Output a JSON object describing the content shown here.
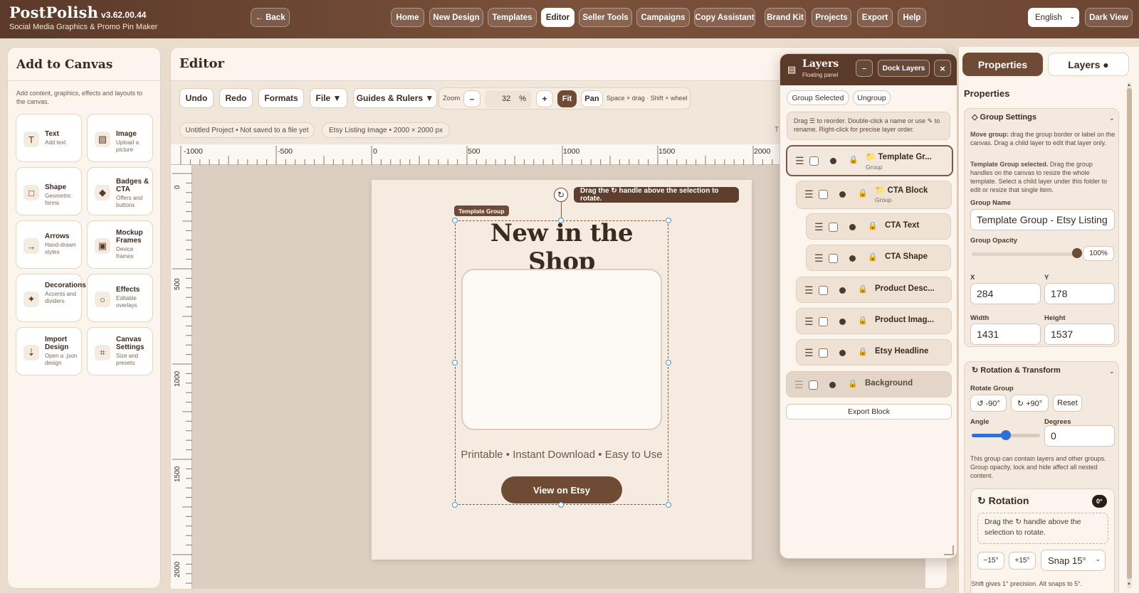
{
  "app": {
    "name": "PostPolish",
    "version": "v3.62.00.44",
    "tagline": "Social Media Graphics & Promo Pin Maker"
  },
  "topbar": {
    "back": "← Back",
    "nav": [
      "Home",
      "New Design",
      "Templates",
      "Editor",
      "Seller Tools",
      "Campaigns",
      "Copy Assistant",
      "Brand Kit",
      "Projects",
      "Export",
      "Help"
    ],
    "active": "Editor",
    "language": "English",
    "dark_view": "Dark View"
  },
  "left_panel": {
    "title": "Add to Canvas",
    "description": "Add content, graphics, effects and layouts to the canvas.",
    "tools": [
      {
        "title": "Text",
        "sub": "Add text",
        "icon": "T"
      },
      {
        "title": "Image",
        "sub": "Upload a picture",
        "icon": "▧"
      },
      {
        "title": "Shape",
        "sub": "Geometric forms",
        "icon": "□"
      },
      {
        "title": "Badges & CTA",
        "sub": "Offers and buttons",
        "icon": "◆"
      },
      {
        "title": "Arrows",
        "sub": "Hand-drawn styles",
        "icon": "→"
      },
      {
        "title": "Mockup Frames",
        "sub": "Device frames",
        "icon": "▣"
      },
      {
        "title": "Decorations",
        "sub": "Accents and dividers",
        "icon": "✦"
      },
      {
        "title": "Effects",
        "sub": "Editable overlays",
        "icon": "○"
      },
      {
        "title": "Import Design",
        "sub": "Open a .json design",
        "icon": "⇣"
      },
      {
        "title": "Canvas Settings",
        "sub": "Size and presets",
        "icon": "⌗"
      }
    ]
  },
  "editor": {
    "title": "Editor",
    "toolbar": {
      "undo": "Undo",
      "redo": "Redo",
      "formats": "Formats",
      "file": "File ▼",
      "guides": "Guides & Rulers ▼",
      "zoom_label": "Zoom",
      "zoom_minus": "–",
      "zoom_value": "32",
      "zoom_unit": "%",
      "zoom_plus": "+",
      "fit": "Fit",
      "pan": "Pan",
      "hint": "Space + drag · Shift + wheel"
    },
    "project_status": "Untitled Project • Not saved to a file yet",
    "canvas_info": "Etsy Listing Image • 2000 × 2000 px",
    "cut_text": "T",
    "ruler_x": [
      "-1000",
      "-500",
      "0",
      "500",
      "1000",
      "1500",
      "2000"
    ],
    "ruler_y": [
      "0",
      "500",
      "1000",
      "1500",
      "2000"
    ],
    "canvas": {
      "group_tag": "Template Group",
      "tip": "Drag the ↻ handle above the selection to rotate.",
      "headline": "New in the Shop",
      "description": "Printable • Instant Download • Easy to Use",
      "cta": "View on Etsy"
    }
  },
  "layers_panel": {
    "title": "Layers",
    "subtitle": "Floating panel",
    "minimize": "–",
    "dock": "Dock Layers",
    "close": "×",
    "group_selected": "Group Selected",
    "ungroup": "Ungroup",
    "hint": "Drag ☰ to reorder. Double-click a name or use ✎ to rename. Right-click for precise layer order.",
    "layers": [
      {
        "name": "Template Gr...",
        "kind": "Group",
        "folder": true
      },
      {
        "name": "CTA Block",
        "kind": "Group",
        "folder": true
      },
      {
        "name": "CTA Text",
        "kind": ""
      },
      {
        "name": "CTA Shape",
        "kind": ""
      },
      {
        "name": "Product Desc...",
        "kind": ""
      },
      {
        "name": "Product Imag...",
        "kind": ""
      },
      {
        "name": "Etsy Headline",
        "kind": ""
      },
      {
        "name": "Background",
        "kind": ""
      }
    ],
    "export_block": "Export Block"
  },
  "properties": {
    "tab_properties": "Properties",
    "tab_layers": "Layers ●",
    "heading": "Properties",
    "group_settings": {
      "title": "Group Settings",
      "move_bold": "Move group:",
      "move_text": "drag the group border or label on the canvas. Drag a child layer to edit that layer only.",
      "selected_bold": "Template Group selected.",
      "selected_text": "Drag the group handles on the canvas to resize the whole template. Select a child layer under this folder to edit or resize that single item.",
      "name_label": "Group Name",
      "name_value": "Template Group - Etsy Listing",
      "opacity_label": "Group Opacity",
      "opacity_value": "100%",
      "opacity_fraction": 1.0,
      "x_label": "X",
      "x_value": "284",
      "y_label": "Y",
      "y_value": "178",
      "w_label": "Width",
      "w_value": "1431",
      "h_label": "Height",
      "h_value": "1537"
    },
    "rotation_transform": {
      "title": "Rotation & Transform",
      "rotate_label": "Rotate Group",
      "minus90": "↺ -90°",
      "plus90": "↻ +90°",
      "reset": "Reset",
      "angle_label": "Angle",
      "degrees_label": "Degrees",
      "degrees_value": "0",
      "angle_fraction": 0.5,
      "note": "This group can contain layers and other groups. Group opacity, lock and hide affect all nested content."
    },
    "rotation": {
      "title": "Rotation",
      "badge": "0°",
      "hint": "Drag the ↻ handle above the selection to rotate.",
      "minus15": "−15°",
      "plus15": "+15°",
      "snap": "Snap 15°",
      "footer": "Shift gives 1° precision. Alt snaps to 5°."
    }
  },
  "colors": {
    "brand": "#5b3a29",
    "accent": "#6f4a35",
    "handle": "#4a90d9",
    "canvas_bg": "#f5ebe0"
  }
}
